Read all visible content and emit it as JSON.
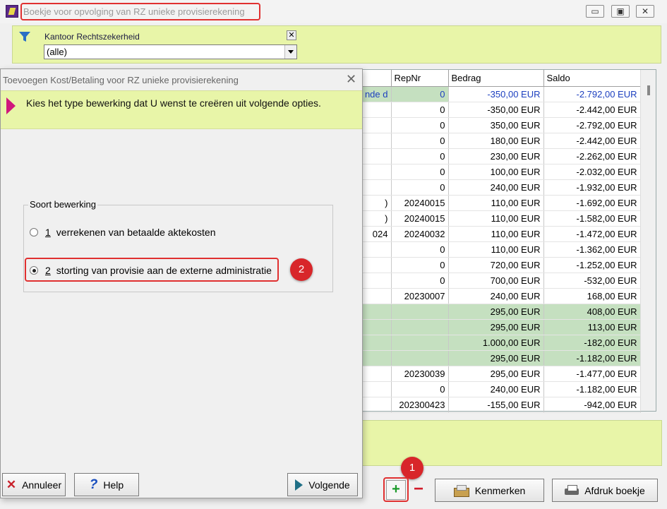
{
  "window": {
    "title": "Boekje voor opvolging van RZ unieke provisierekening",
    "minimize": "▭",
    "restore": "▣",
    "close": "✕"
  },
  "filter": {
    "label": "Kantoor Rechtszekerheid",
    "value": "(alle)",
    "clear": "✕"
  },
  "table": {
    "headers": [
      "RepNr",
      "Bedrag",
      "Saldo"
    ],
    "rows": [
      {
        "c0": "nde d",
        "repnr": "0",
        "bedrag": "-350,00 EUR",
        "saldo": "-2.792,00 EUR",
        "style": "selected"
      },
      {
        "c0": "",
        "repnr": "0",
        "bedrag": "-350,00 EUR",
        "saldo": "-2.442,00 EUR",
        "style": ""
      },
      {
        "c0": "",
        "repnr": "0",
        "bedrag": "350,00 EUR",
        "saldo": "-2.792,00 EUR",
        "style": ""
      },
      {
        "c0": "",
        "repnr": "0",
        "bedrag": "180,00 EUR",
        "saldo": "-2.442,00 EUR",
        "style": ""
      },
      {
        "c0": "",
        "repnr": "0",
        "bedrag": "230,00 EUR",
        "saldo": "-2.262,00 EUR",
        "style": ""
      },
      {
        "c0": "",
        "repnr": "0",
        "bedrag": "100,00 EUR",
        "saldo": "-2.032,00 EUR",
        "style": ""
      },
      {
        "c0": "",
        "repnr": "0",
        "bedrag": "240,00 EUR",
        "saldo": "-1.932,00 EUR",
        "style": ""
      },
      {
        "c0": ")",
        "repnr": "20240015",
        "bedrag": "110,00 EUR",
        "saldo": "-1.692,00 EUR",
        "style": ""
      },
      {
        "c0": ")",
        "repnr": "20240015",
        "bedrag": "110,00 EUR",
        "saldo": "-1.582,00 EUR",
        "style": ""
      },
      {
        "c0": "024",
        "repnr": "20240032",
        "bedrag": "110,00 EUR",
        "saldo": "-1.472,00 EUR",
        "style": ""
      },
      {
        "c0": "",
        "repnr": "0",
        "bedrag": "110,00 EUR",
        "saldo": "-1.362,00 EUR",
        "style": ""
      },
      {
        "c0": "",
        "repnr": "0",
        "bedrag": "720,00 EUR",
        "saldo": "-1.252,00 EUR",
        "style": ""
      },
      {
        "c0": "",
        "repnr": "0",
        "bedrag": "700,00 EUR",
        "saldo": "-532,00 EUR",
        "style": ""
      },
      {
        "c0": "",
        "repnr": "20230007",
        "bedrag": "240,00 EUR",
        "saldo": "168,00 EUR",
        "style": ""
      },
      {
        "c0": "",
        "repnr": "",
        "bedrag": "295,00 EUR",
        "saldo": "408,00 EUR",
        "style": "green"
      },
      {
        "c0": "",
        "repnr": "",
        "bedrag": "295,00 EUR",
        "saldo": "113,00 EUR",
        "style": "green"
      },
      {
        "c0": "",
        "repnr": "",
        "bedrag": "1.000,00 EUR",
        "saldo": "-182,00 EUR",
        "style": "green"
      },
      {
        "c0": "",
        "repnr": "",
        "bedrag": "295,00 EUR",
        "saldo": "-1.182,00 EUR",
        "style": "green"
      },
      {
        "c0": "",
        "repnr": "20230039",
        "bedrag": "295,00 EUR",
        "saldo": "-1.477,00 EUR",
        "style": ""
      },
      {
        "c0": "",
        "repnr": "0",
        "bedrag": "240,00 EUR",
        "saldo": "-1.182,00 EUR",
        "style": ""
      },
      {
        "c0": "",
        "repnr": "202300423",
        "bedrag": "-155,00 EUR",
        "saldo": "-942,00 EUR",
        "style": ""
      }
    ]
  },
  "toolbar": {
    "add": "+",
    "remove": "−",
    "kenmerken": "Kenmerken",
    "afdruk": "Afdruk boekje"
  },
  "annotations": {
    "badge1": "1",
    "badge2": "2",
    "highlight_color": "#e03030"
  },
  "dialog": {
    "title": "Toevoegen Kost/Betaling voor RZ unieke provisierekening",
    "close": "✕",
    "instruction": "Kies het type bewerking dat U wenst te creëren uit volgende opties.",
    "group_label": "Soort bewerking",
    "options": [
      {
        "num": "1",
        "label": "verrekenen van betaalde aktekosten",
        "checked": false
      },
      {
        "num": "2",
        "label": "storting van provisie aan de externe administratie",
        "checked": true
      }
    ],
    "buttons": {
      "cancel": "Annuleer",
      "help": "Help",
      "next": "Volgende"
    }
  },
  "icons": {
    "app": "app-icon",
    "filter": "funnel-icon",
    "kenmerken": "folder-icon",
    "print": "printer-icon",
    "cancel": "x-icon",
    "help": "question-icon",
    "next": "play-icon"
  }
}
